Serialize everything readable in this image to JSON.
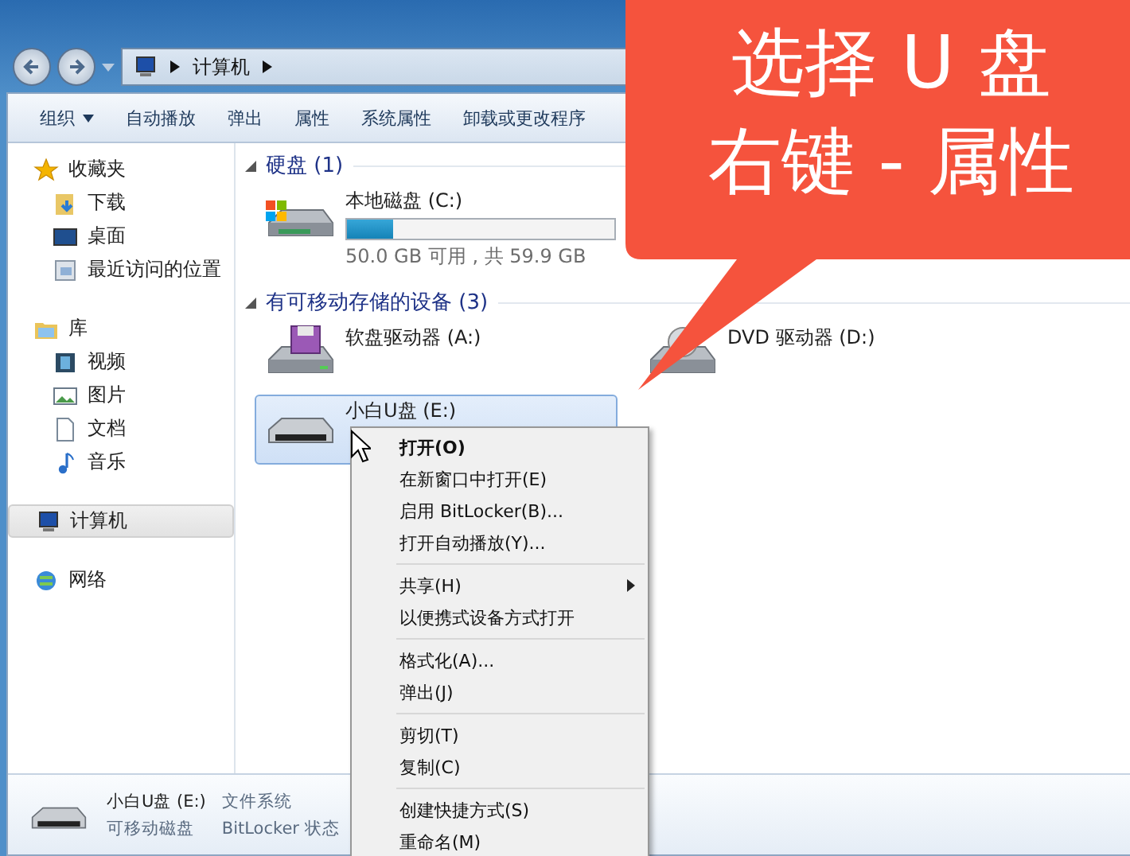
{
  "address_bar": {
    "crumbs": [
      "计算机"
    ]
  },
  "toolbar": {
    "items": [
      {
        "label": "组织",
        "dropdown": true
      },
      {
        "label": "自动播放",
        "dropdown": false
      },
      {
        "label": "弹出",
        "dropdown": false
      },
      {
        "label": "属性",
        "dropdown": false
      },
      {
        "label": "系统属性",
        "dropdown": false
      },
      {
        "label": "卸载或更改程序",
        "dropdown": false
      }
    ]
  },
  "sidebar": {
    "groups": [
      {
        "label": "收藏夹",
        "selected": false,
        "children": [
          {
            "label": "下载"
          },
          {
            "label": "桌面"
          },
          {
            "label": "最近访问的位置"
          }
        ]
      },
      {
        "label": "库",
        "selected": false,
        "children": [
          {
            "label": "视频"
          },
          {
            "label": "图片"
          },
          {
            "label": "文档"
          },
          {
            "label": "音乐"
          }
        ]
      },
      {
        "label": "计算机",
        "selected": true
      },
      {
        "label": "网络",
        "selected": false
      }
    ]
  },
  "sections": [
    {
      "title": "硬盘 (1)",
      "drives": [
        {
          "kind": "hdd",
          "name": "本地磁盘 (C:)",
          "level": 0.17,
          "info": "50.0 GB 可用 , 共 59.9 GB",
          "selected": false
        }
      ]
    },
    {
      "title": "有可移动存储的设备 (3)",
      "drives": [
        {
          "kind": "floppy",
          "name": "软盘驱动器 (A:)",
          "selected": false
        },
        {
          "kind": "dvd",
          "name": "DVD 驱动器 (D:)",
          "selected": false
        },
        {
          "kind": "usb",
          "name": "小白U盘 (E:)",
          "selected": true
        }
      ]
    }
  ],
  "context_menu": {
    "groups": [
      [
        {
          "label": "打开(O)",
          "default": true,
          "submenu": false
        },
        {
          "label": "在新窗口中打开(E)",
          "default": false,
          "submenu": false
        },
        {
          "label": "启用 BitLocker(B)...",
          "default": false,
          "submenu": false
        },
        {
          "label": "打开自动播放(Y)...",
          "default": false,
          "submenu": false
        }
      ],
      [
        {
          "label": "共享(H)",
          "default": false,
          "submenu": true
        },
        {
          "label": "以便携式设备方式打开",
          "default": false,
          "submenu": false
        }
      ],
      [
        {
          "label": "格式化(A)...",
          "default": false,
          "submenu": false
        },
        {
          "label": "弹出(J)",
          "default": false,
          "submenu": false
        }
      ],
      [
        {
          "label": "剪切(T)",
          "default": false,
          "submenu": false
        },
        {
          "label": "复制(C)",
          "default": false,
          "submenu": false
        }
      ],
      [
        {
          "label": "创建快捷方式(S)",
          "default": false,
          "submenu": false
        },
        {
          "label": "重命名(M)",
          "default": false,
          "submenu": false
        }
      ]
    ]
  },
  "details": {
    "name": "小白U盘 (E:)",
    "type": "可移动磁盘",
    "field_1": "文件系统",
    "field_2": "BitLocker 状态"
  },
  "callout": {
    "lines": [
      "选择 U 盘",
      "右键 - 属性"
    ]
  }
}
